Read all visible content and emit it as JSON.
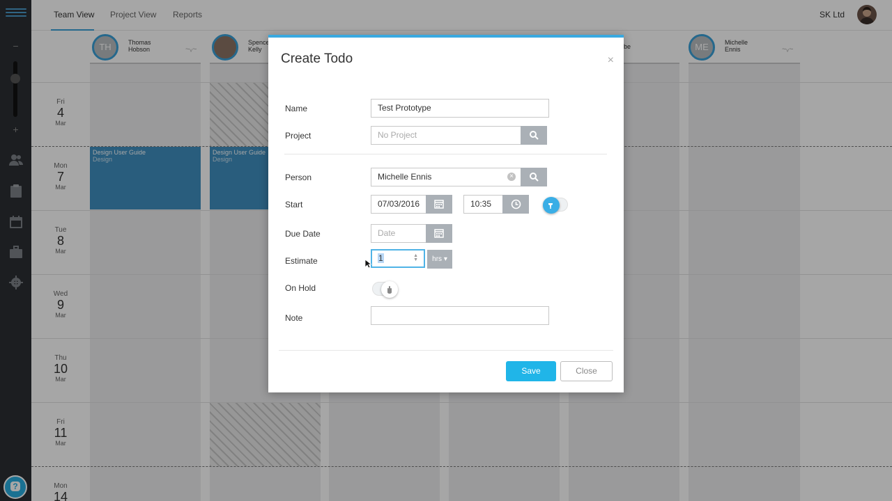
{
  "topbar": {
    "tabs": [
      {
        "label": "Team View",
        "active": true
      },
      {
        "label": "Project View",
        "active": false
      },
      {
        "label": "Reports",
        "active": false
      }
    ],
    "company": "SK Ltd"
  },
  "people": [
    {
      "initials": "TH",
      "first": "Thomas",
      "last": "Hobson"
    },
    {
      "initials": "",
      "first": "Spencer",
      "last": "Kelly"
    },
    {
      "initials": "",
      "first": "",
      "last": ""
    },
    {
      "initials": "",
      "first": "",
      "last": ""
    },
    {
      "initials": "",
      "first": "",
      "last": "be"
    },
    {
      "initials": "ME",
      "first": "Michelle",
      "last": "Ennis"
    }
  ],
  "dates": [
    {
      "weekday": "Fri",
      "day": "4",
      "month": "Mar"
    },
    {
      "weekday": "Mon",
      "day": "7",
      "month": "Mar"
    },
    {
      "weekday": "Tue",
      "day": "8",
      "month": "Mar"
    },
    {
      "weekday": "Wed",
      "day": "9",
      "month": "Mar"
    },
    {
      "weekday": "Thu",
      "day": "10",
      "month": "Mar"
    },
    {
      "weekday": "Fri",
      "day": "11",
      "month": "Mar"
    },
    {
      "weekday": "Mon",
      "day": "14",
      "month": ""
    }
  ],
  "tasks": [
    {
      "title": "Design User Guide",
      "project": "Design"
    },
    {
      "title": "Design User Guide",
      "project": "Design"
    }
  ],
  "modal": {
    "title": "Create Todo",
    "close_x": "×",
    "fields": {
      "name": {
        "label": "Name",
        "value": "Test Prototype"
      },
      "project": {
        "label": "Project",
        "placeholder": "No Project"
      },
      "person": {
        "label": "Person",
        "value": "Michelle  Ennis"
      },
      "start": {
        "label": "Start",
        "date": "07/03/2016",
        "time": "10:35"
      },
      "due_date": {
        "label": "Due Date",
        "placeholder": "Date"
      },
      "estimate": {
        "label": "Estimate",
        "value": "1",
        "unit": "hrs"
      },
      "on_hold": {
        "label": "On Hold"
      },
      "note": {
        "label": "Note",
        "value": ""
      }
    },
    "save_label": "Save",
    "close_label": "Close"
  },
  "colors": {
    "accent": "#20b5e8",
    "sidebar": "#2b2e33",
    "task": "#3f8fc0"
  }
}
